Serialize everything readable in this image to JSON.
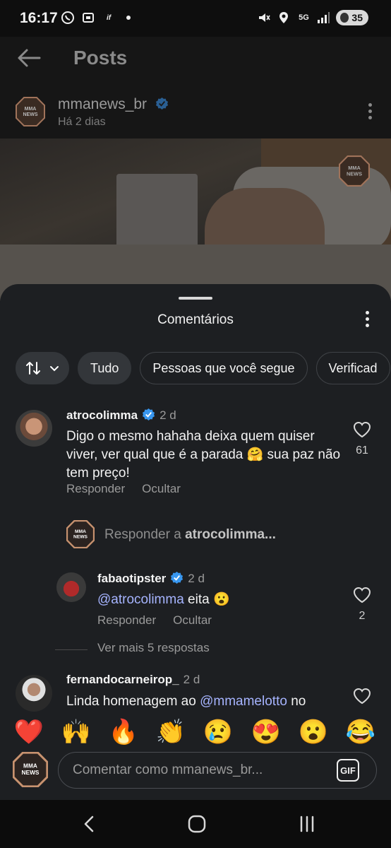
{
  "status_bar": {
    "time": "16:17",
    "left_icons": [
      "whatsapp-icon",
      "screenshot-icon",
      "ifood-icon"
    ],
    "network": "5G",
    "battery": "35"
  },
  "header": {
    "title": "Posts"
  },
  "post": {
    "author": "mmanews_br",
    "time": "Há 2 dias",
    "logo_text": "MMA NEWS"
  },
  "comments_sheet": {
    "title": "Comentários",
    "filters": [
      "Tudo",
      "Pessoas que você segue",
      "Verificad"
    ],
    "comments": [
      {
        "user": "atrocolimma",
        "time": "2 d",
        "text": "Digo o mesmo hahaha deixa quem quiser viver, ver qual que é a parada 🤗 sua paz não tem preço!",
        "likes": "61",
        "reply_label": "Responder",
        "hide_label": "Ocultar"
      },
      {
        "user": "fabaotipster",
        "time": "2 d",
        "mention": "@atrocolimma",
        "text": " eita 😮",
        "likes": "2",
        "reply_label": "Responder",
        "hide_label": "Ocultar"
      },
      {
        "user": "fernandocarneirop_",
        "time": "2 d",
        "text_prefix": "Linda homenagem ao ",
        "mention": "@mmamelotto",
        "text_suffix": " no"
      }
    ],
    "reply_prompt_prefix": "Responder a ",
    "reply_prompt_user": "atrocolimma...",
    "view_more": "Ver mais 5 respostas"
  },
  "emoji_bar": [
    "❤️",
    "🙌",
    "🔥",
    "👏",
    "😢",
    "😍",
    "😮",
    "😂"
  ],
  "composer": {
    "placeholder": "Comentar como mmanews_br...",
    "gif_label": "GIF"
  },
  "colors": {
    "sheet_bg": "#1d1f22",
    "mention": "#a6b4ff",
    "verified": "#3897f0",
    "like_heart": "#ff3040"
  }
}
